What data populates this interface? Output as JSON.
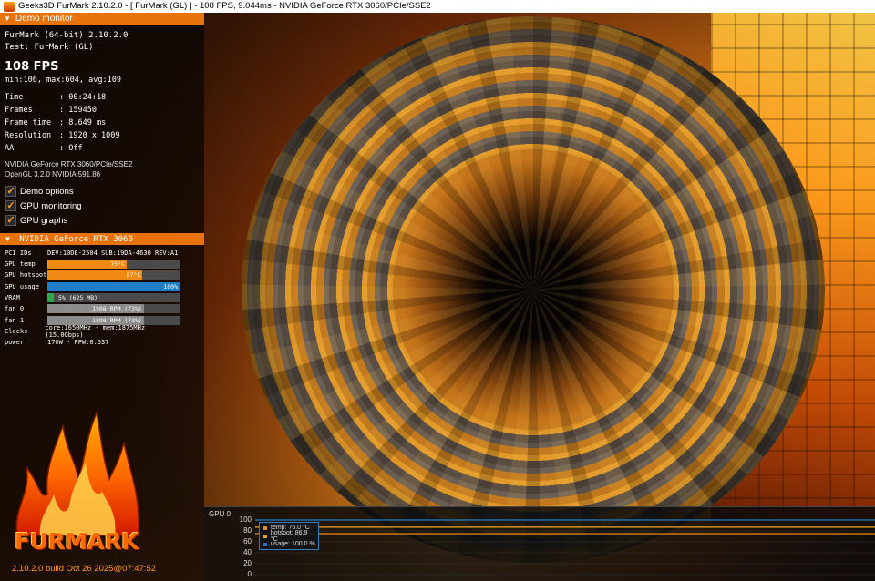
{
  "window": {
    "title": "Geeks3D FurMark 2.10.2.0 - [ FurMark (GL) ] - 108 FPS, 9.044ms - NVIDIA GeForce RTX 3060/PCIe/SSE2"
  },
  "demo_monitor": {
    "header": "Demo monitor",
    "app_line": "FurMark (64-bit) 2.10.2.0",
    "test_line": "Test: FurMark (GL)",
    "fps": "108 FPS",
    "fps_stats": "min:106, max:604, avg:109",
    "stats": [
      {
        "key": "Time",
        "value": ": 00:24:18"
      },
      {
        "key": "Frames",
        "value": ": 159450"
      },
      {
        "key": "Frame time",
        "value": ": 8.649 ms"
      },
      {
        "key": "Resolution",
        "value": ": 1920 x 1009"
      },
      {
        "key": "AA",
        "value": ": Off"
      }
    ],
    "renderer": "NVIDIA GeForce RTX 3060/PCIe/SSE2",
    "opengl": "OpenGL 3.2.0 NVIDIA 591.86",
    "checkboxes": [
      {
        "label": "Demo options",
        "mark": "✓"
      },
      {
        "label": "GPU monitoring",
        "mark": "✓"
      },
      {
        "label": "GPU graphs",
        "mark": "✓"
      }
    ]
  },
  "gpu_monitor": {
    "header": "NVIDIA GeForce RTX 3060",
    "pci_label": "PCI IDs",
    "pci_value": "DEV:10DE-2504 SUB:19DA-4630 REV:A1",
    "bars": [
      {
        "label": "GPU temp",
        "text": "75°C",
        "fill": 0.6,
        "color": "#f08a12"
      },
      {
        "label": "GPU hotspot",
        "text": "87°C",
        "fill": 0.72,
        "color": "#f08a12"
      },
      {
        "label": "GPU usage",
        "text": "100%",
        "fill": 1.0,
        "color": "#1e7fc8"
      },
      {
        "label": "VRAM",
        "text": "5% (625 MB)",
        "fill": 0.05,
        "color": "#2aa84a"
      },
      {
        "label": "fan 0",
        "text": "1908 RPM (73%)",
        "fill": 0.73,
        "color": "#8c8c8c"
      },
      {
        "label": "fan 1",
        "text": "1898 RPM (73%)",
        "fill": 0.73,
        "color": "#8c8c8c"
      }
    ],
    "clocks_label": "Clocks",
    "clocks_value": "core:1650MHz - mem:1875MHz (15.0Gbps)",
    "power_label": "power",
    "power_value": "170W - PPW:0.637"
  },
  "logo": {
    "word": "FURMARK",
    "build": "2.10.2.0 build Oct 26 2025@07:47:52"
  },
  "graph": {
    "title": "GPU 0",
    "yticks": [
      "100",
      "80",
      "60",
      "40",
      "20",
      "0"
    ],
    "legend": [
      {
        "label": "temp: 75.0 °C",
        "color": "#f08a12"
      },
      {
        "label": "hotspot: 86.9 °C",
        "color": "#f5a623"
      },
      {
        "label": "usage: 100.0 %",
        "color": "#1e7fc8"
      }
    ],
    "series_levels": {
      "temp": 75.0,
      "hotspot": 86.9,
      "usage": 100.0
    }
  }
}
